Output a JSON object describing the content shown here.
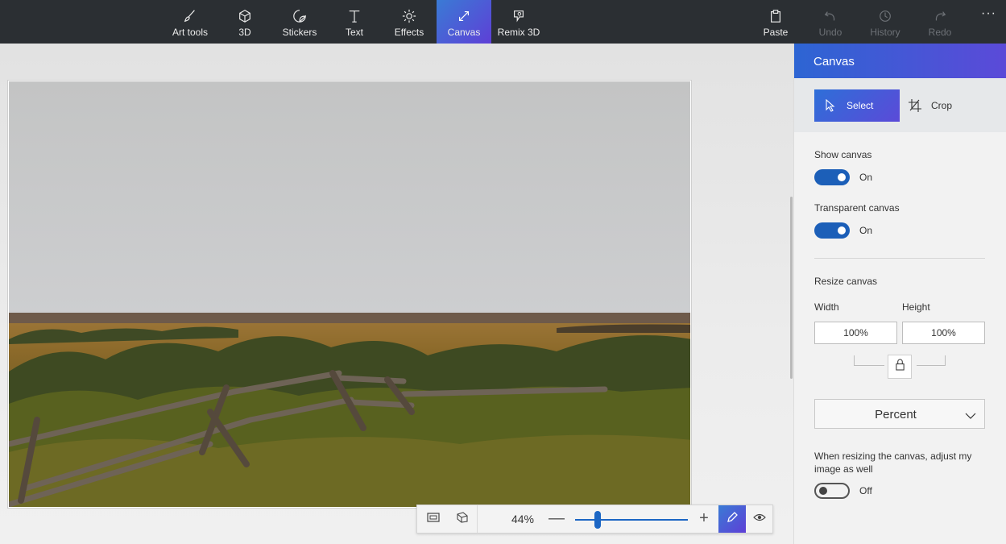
{
  "toolbar": {
    "tools": [
      {
        "id": "art-tools",
        "label": "Art tools",
        "icon": "brush-icon"
      },
      {
        "id": "3d",
        "label": "3D",
        "icon": "cube-icon"
      },
      {
        "id": "stickers",
        "label": "Stickers",
        "icon": "sticker-icon"
      },
      {
        "id": "text",
        "label": "Text",
        "icon": "text-icon"
      },
      {
        "id": "effects",
        "label": "Effects",
        "icon": "sun-icon"
      },
      {
        "id": "canvas",
        "label": "Canvas",
        "icon": "resize-arrows-icon",
        "active": true
      },
      {
        "id": "remix-3d",
        "label": "Remix 3D",
        "icon": "remix-icon"
      }
    ],
    "actions": [
      {
        "id": "paste",
        "label": "Paste",
        "icon": "clipboard-icon",
        "enabled": true
      },
      {
        "id": "undo",
        "label": "Undo",
        "icon": "undo-icon",
        "enabled": false
      },
      {
        "id": "history",
        "label": "History",
        "icon": "history-icon",
        "enabled": false
      },
      {
        "id": "redo",
        "label": "Redo",
        "icon": "redo-icon",
        "enabled": false
      }
    ],
    "more_label": "···",
    "accent": "#3a7bd5"
  },
  "zoom": {
    "percent_label": "44%",
    "minus_label": "—",
    "plus_label": "+",
    "slider_fraction": 0.2
  },
  "panel": {
    "title": "Canvas",
    "select_label": "Select",
    "crop_label": "Crop",
    "show_canvas": {
      "label": "Show canvas",
      "state": "On",
      "on": true
    },
    "transparent_canvas": {
      "label": "Transparent canvas",
      "state": "On",
      "on": true
    },
    "resize_title": "Resize canvas",
    "width_label": "Width",
    "height_label": "Height",
    "width_value": "100%",
    "height_value": "100%",
    "unit": "Percent",
    "adjust_note": "When resizing the canvas, adjust my image as well",
    "adjust_state": "Off",
    "adjust_on": false
  }
}
